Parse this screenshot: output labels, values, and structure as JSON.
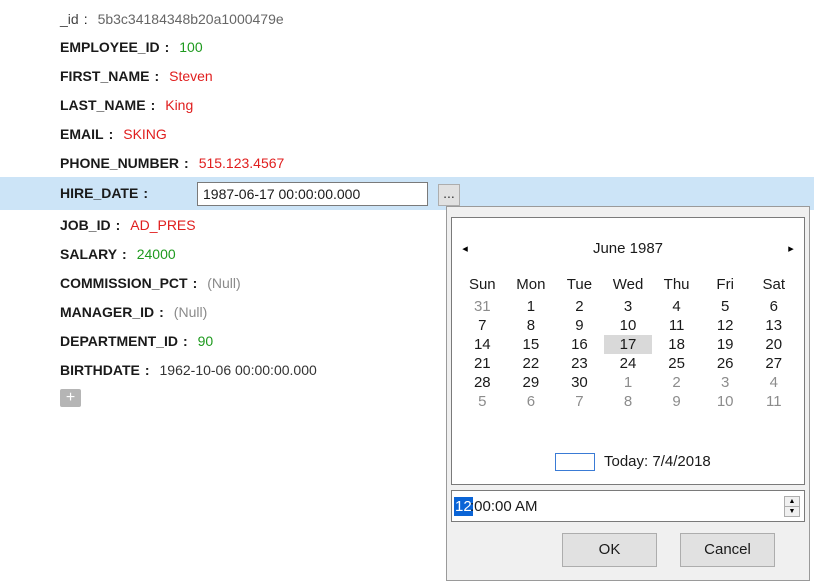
{
  "record": {
    "fields": [
      {
        "key": "_id",
        "value": "5b3c34184348b20a1000479e"
      },
      {
        "key": "EMPLOYEE_ID",
        "value": "100"
      },
      {
        "key": "FIRST_NAME",
        "value": "Steven"
      },
      {
        "key": "LAST_NAME",
        "value": "King"
      },
      {
        "key": "EMAIL",
        "value": "SKING"
      },
      {
        "key": "PHONE_NUMBER",
        "value": "515.123.4567"
      },
      {
        "key": "HIRE_DATE",
        "value": "1987-06-17 00:00:00.000"
      },
      {
        "key": "JOB_ID",
        "value": "AD_PRES"
      },
      {
        "key": "SALARY",
        "value": "24000"
      },
      {
        "key": "COMMISSION_PCT",
        "value": "(Null)"
      },
      {
        "key": "MANAGER_ID",
        "value": "(Null)"
      },
      {
        "key": "DEPARTMENT_ID",
        "value": "90"
      },
      {
        "key": "BIRTHDATE",
        "value": "1962-10-06 00:00:00.000"
      }
    ],
    "separator": ":",
    "browse_button": "...",
    "add_button": "+"
  },
  "calendar": {
    "prev_icon": "◂",
    "next_icon": "▸",
    "month_title": "June 1987",
    "days_of_week": [
      "Sun",
      "Mon",
      "Tue",
      "Wed",
      "Thu",
      "Fri",
      "Sat"
    ],
    "weeks": [
      [
        "31",
        "1",
        "2",
        "3",
        "4",
        "5",
        "6"
      ],
      [
        "7",
        "8",
        "9",
        "10",
        "11",
        "12",
        "13"
      ],
      [
        "14",
        "15",
        "16",
        "17",
        "18",
        "19",
        "20"
      ],
      [
        "21",
        "22",
        "23",
        "24",
        "25",
        "26",
        "27"
      ],
      [
        "28",
        "29",
        "30",
        "1",
        "2",
        "3",
        "4"
      ],
      [
        "5",
        "6",
        "7",
        "8",
        "9",
        "10",
        "11"
      ]
    ],
    "selected_day": "17",
    "today_label": "Today: 7/4/2018"
  },
  "time": {
    "hour": "12",
    "rest": ":00:00 AM",
    "spin_up": "▲",
    "spin_down": "▼"
  },
  "buttons": {
    "ok": "OK",
    "cancel": "Cancel"
  }
}
